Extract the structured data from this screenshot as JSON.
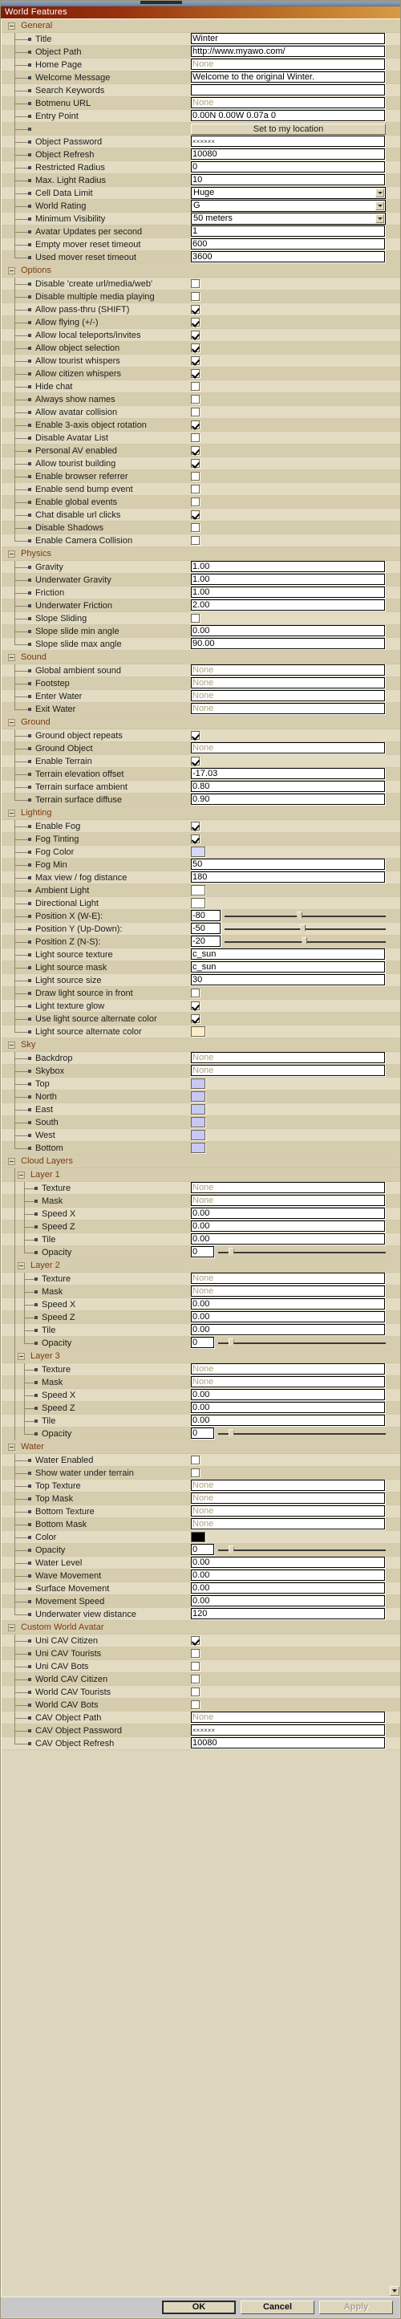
{
  "window": {
    "title": "World Features"
  },
  "buttons": {
    "ok": "OK",
    "cancel": "Cancel",
    "apply": "Apply"
  },
  "set_location_button": "Set to my location",
  "colors": {
    "fog_color": "#d8d8f8",
    "ambient_light": "#ffffff",
    "directional_light": "#ffffff",
    "light_source_alternate_color": "#fbeec6",
    "sky_top": "#c8c8f5",
    "sky_north": "#c8c8f5",
    "sky_east": "#c8c8f5",
    "sky_south": "#c8c8f5",
    "sky_west": "#c8c8f5",
    "sky_bottom": "#c8c8f5",
    "water_color": "#000000"
  },
  "groups": [
    {
      "name": "General",
      "rows": [
        {
          "label": "Title",
          "type": "text",
          "value": "Winter"
        },
        {
          "label": "Object Path",
          "type": "text",
          "value": "http://www.myawo.com/"
        },
        {
          "label": "Home Page",
          "type": "text",
          "value": "None",
          "none": true
        },
        {
          "label": "Welcome Message",
          "type": "text",
          "value": "Welcome to the original Winter."
        },
        {
          "label": "Search Keywords",
          "type": "text",
          "value": ""
        },
        {
          "label": "Botmenu URL",
          "type": "text",
          "value": "None",
          "none": true
        },
        {
          "label": "Entry Point",
          "type": "text",
          "value": "0.00N 0.00W 0.07a 0"
        },
        {
          "label": "",
          "type": "button",
          "value": "Set to my location"
        },
        {
          "label": "Object Password",
          "type": "password",
          "value": "××××××"
        },
        {
          "label": "Object Refresh",
          "type": "text",
          "value": "10080"
        },
        {
          "label": "Restricted Radius",
          "type": "text",
          "value": "0"
        },
        {
          "label": "Max. Light Radius",
          "type": "text",
          "value": "10"
        },
        {
          "label": "Cell Data Limit",
          "type": "combo",
          "value": "Huge"
        },
        {
          "label": "World Rating",
          "type": "combo",
          "value": "G"
        },
        {
          "label": "Minimum Visibility",
          "type": "combo",
          "value": "50 meters"
        },
        {
          "label": "Avatar Updates per second",
          "type": "text",
          "value": "1"
        },
        {
          "label": "Empty mover reset timeout",
          "type": "text",
          "value": "600"
        },
        {
          "label": "Used mover reset timeout",
          "type": "text",
          "value": "3600"
        }
      ]
    },
    {
      "name": "Options",
      "rows": [
        {
          "label": "Disable 'create url/media/web'",
          "type": "check",
          "value": false
        },
        {
          "label": "Disable multiple media playing",
          "type": "check",
          "value": false
        },
        {
          "label": "Allow pass-thru (SHIFT)",
          "type": "check",
          "value": true
        },
        {
          "label": "Allow flying (+/-)",
          "type": "check",
          "value": true
        },
        {
          "label": "Allow local teleports/invites",
          "type": "check",
          "value": true
        },
        {
          "label": "Allow object selection",
          "type": "check",
          "value": true
        },
        {
          "label": "Allow tourist whispers",
          "type": "check",
          "value": true
        },
        {
          "label": "Allow citizen whispers",
          "type": "check",
          "value": true
        },
        {
          "label": "Hide chat",
          "type": "check",
          "value": false
        },
        {
          "label": "Always show names",
          "type": "check",
          "value": false
        },
        {
          "label": "Allow avatar collision",
          "type": "check",
          "value": false
        },
        {
          "label": "Enable 3-axis object rotation",
          "type": "check",
          "value": true
        },
        {
          "label": "Disable Avatar List",
          "type": "check",
          "value": false
        },
        {
          "label": "Personal AV enabled",
          "type": "check",
          "value": true
        },
        {
          "label": "Allow tourist building",
          "type": "check",
          "value": true
        },
        {
          "label": "Enable browser referrer",
          "type": "check",
          "value": false
        },
        {
          "label": "Enable send bump event",
          "type": "check",
          "value": false
        },
        {
          "label": "Enable global events",
          "type": "check",
          "value": false
        },
        {
          "label": "Chat disable url clicks",
          "type": "check",
          "value": true
        },
        {
          "label": "Disable Shadows",
          "type": "check",
          "value": false
        },
        {
          "label": "Enable Camera Collision",
          "type": "check",
          "value": false
        }
      ]
    },
    {
      "name": "Physics",
      "rows": [
        {
          "label": "Gravity",
          "type": "text",
          "value": "1.00"
        },
        {
          "label": "Underwater Gravity",
          "type": "text",
          "value": "1.00"
        },
        {
          "label": "Friction",
          "type": "text",
          "value": "1.00"
        },
        {
          "label": "Underwater Friction",
          "type": "text",
          "value": "2.00"
        },
        {
          "label": "Slope Sliding",
          "type": "check",
          "value": false
        },
        {
          "label": "Slope slide min angle",
          "type": "text",
          "value": "0.00"
        },
        {
          "label": "Slope slide max angle",
          "type": "text",
          "value": "90.00"
        }
      ]
    },
    {
      "name": "Sound",
      "rows": [
        {
          "label": "Global ambient sound",
          "type": "text",
          "value": "None",
          "none": true
        },
        {
          "label": "Footstep",
          "type": "text",
          "value": "None",
          "none": true
        },
        {
          "label": "Enter Water",
          "type": "text",
          "value": "None",
          "none": true
        },
        {
          "label": "Exit Water",
          "type": "text",
          "value": "None",
          "none": true
        }
      ]
    },
    {
      "name": "Ground",
      "rows": [
        {
          "label": "Ground object repeats",
          "type": "check",
          "value": true
        },
        {
          "label": "Ground Object",
          "type": "text",
          "value": "None",
          "none": true
        },
        {
          "label": "Enable Terrain",
          "type": "check",
          "value": true
        },
        {
          "label": "Terrain elevation offset",
          "type": "text",
          "value": "-17.03"
        },
        {
          "label": "Terrain surface ambient",
          "type": "text",
          "value": "0.80"
        },
        {
          "label": "Terrain surface diffuse",
          "type": "text",
          "value": "0.90"
        }
      ]
    },
    {
      "name": "Lighting",
      "rows": [
        {
          "label": "Enable Fog",
          "type": "check",
          "value": true
        },
        {
          "label": "Fog Tinting",
          "type": "check",
          "value": true
        },
        {
          "label": "Fog Color",
          "type": "color",
          "value": "#d8d8f8"
        },
        {
          "label": "Fog Min",
          "type": "text",
          "value": "50"
        },
        {
          "label": "Max view / fog distance",
          "type": "text",
          "value": "180"
        },
        {
          "label": "Ambient Light",
          "type": "color",
          "value": "#ffffff"
        },
        {
          "label": "Directional Light",
          "type": "color",
          "value": "#ffffff"
        },
        {
          "label": "Position X (W-E):",
          "type": "slider",
          "value": "-80",
          "pos": 45
        },
        {
          "label": "Position Y (Up-Down):",
          "type": "slider",
          "value": "-50",
          "pos": 47
        },
        {
          "label": "Position Z (N-S):",
          "type": "slider",
          "value": "-20",
          "pos": 48
        },
        {
          "label": "Light source texture",
          "type": "text",
          "value": "c_sun"
        },
        {
          "label": "Light source mask",
          "type": "text",
          "value": "c_sun"
        },
        {
          "label": "Light source size",
          "type": "text",
          "value": "30"
        },
        {
          "label": "Draw light source in front",
          "type": "check",
          "value": false
        },
        {
          "label": "Light texture glow",
          "type": "check",
          "value": true
        },
        {
          "label": "Use light source alternate color",
          "type": "check",
          "value": true
        },
        {
          "label": "Light source alternate color",
          "type": "color",
          "value": "#fbeec6"
        }
      ]
    },
    {
      "name": "Sky",
      "rows": [
        {
          "label": "Backdrop",
          "type": "text",
          "value": "None",
          "none": true
        },
        {
          "label": "Skybox",
          "type": "text",
          "value": "None",
          "none": true
        },
        {
          "label": "Top",
          "type": "color",
          "value": "#c8c8f5"
        },
        {
          "label": "North",
          "type": "color",
          "value": "#c8c8f5"
        },
        {
          "label": "East",
          "type": "color",
          "value": "#c8c8f5"
        },
        {
          "label": "South",
          "type": "color",
          "value": "#c8c8f5"
        },
        {
          "label": "West",
          "type": "color",
          "value": "#c8c8f5"
        },
        {
          "label": "Bottom",
          "type": "color",
          "value": "#c8c8f5"
        }
      ]
    },
    {
      "name": "Cloud Layers",
      "subgroups": [
        {
          "name": "Layer 1",
          "rows": [
            {
              "label": "Texture",
              "type": "text",
              "value": "None",
              "none": true
            },
            {
              "label": "Mask",
              "type": "text",
              "value": "None",
              "none": true
            },
            {
              "label": "Speed X",
              "type": "text",
              "value": "0.00"
            },
            {
              "label": "Speed Z",
              "type": "text",
              "value": "0.00"
            },
            {
              "label": "Tile",
              "type": "text",
              "value": "0.00"
            },
            {
              "label": "Opacity",
              "type": "slider",
              "value": "0",
              "pos": 6
            }
          ]
        },
        {
          "name": "Layer 2",
          "rows": [
            {
              "label": "Texture",
              "type": "text",
              "value": "None",
              "none": true
            },
            {
              "label": "Mask",
              "type": "text",
              "value": "None",
              "none": true
            },
            {
              "label": "Speed X",
              "type": "text",
              "value": "0.00"
            },
            {
              "label": "Speed Z",
              "type": "text",
              "value": "0.00"
            },
            {
              "label": "Tile",
              "type": "text",
              "value": "0.00"
            },
            {
              "label": "Opacity",
              "type": "slider",
              "value": "0",
              "pos": 6
            }
          ]
        },
        {
          "name": "Layer 3",
          "rows": [
            {
              "label": "Texture",
              "type": "text",
              "value": "None",
              "none": true
            },
            {
              "label": "Mask",
              "type": "text",
              "value": "None",
              "none": true
            },
            {
              "label": "Speed X",
              "type": "text",
              "value": "0.00"
            },
            {
              "label": "Speed Z",
              "type": "text",
              "value": "0.00"
            },
            {
              "label": "Tile",
              "type": "text",
              "value": "0.00"
            },
            {
              "label": "Opacity",
              "type": "slider",
              "value": "0",
              "pos": 6
            }
          ]
        }
      ]
    },
    {
      "name": "Water",
      "rows": [
        {
          "label": "Water Enabled",
          "type": "check",
          "value": false
        },
        {
          "label": "Show water under terrain",
          "type": "check",
          "value": false
        },
        {
          "label": "Top Texture",
          "type": "text",
          "value": "None",
          "none": true
        },
        {
          "label": "Top Mask",
          "type": "text",
          "value": "None",
          "none": true
        },
        {
          "label": "Bottom Texture",
          "type": "text",
          "value": "None",
          "none": true
        },
        {
          "label": "Bottom Mask",
          "type": "text",
          "value": "None",
          "none": true
        },
        {
          "label": "Color",
          "type": "color",
          "value": "#000000"
        },
        {
          "label": "Opacity",
          "type": "slider",
          "value": "0",
          "pos": 6
        },
        {
          "label": "Water Level",
          "type": "text",
          "value": "0.00"
        },
        {
          "label": "Wave Movement",
          "type": "text",
          "value": "0.00"
        },
        {
          "label": "Surface Movement",
          "type": "text",
          "value": "0.00"
        },
        {
          "label": "Movement Speed",
          "type": "text",
          "value": "0.00"
        },
        {
          "label": "Underwater view distance",
          "type": "text",
          "value": "120"
        }
      ]
    },
    {
      "name": "Custom World Avatar",
      "rows": [
        {
          "label": "Uni CAV Citizen",
          "type": "check",
          "value": true
        },
        {
          "label": "Uni CAV Tourists",
          "type": "check",
          "value": false
        },
        {
          "label": "Uni CAV Bots",
          "type": "check",
          "value": false
        },
        {
          "label": "World CAV Citizen",
          "type": "check",
          "value": false
        },
        {
          "label": "World CAV Tourists",
          "type": "check",
          "value": false
        },
        {
          "label": "World CAV Bots",
          "type": "check",
          "value": false
        },
        {
          "label": "CAV Object Path",
          "type": "text",
          "value": "None",
          "none": true
        },
        {
          "label": "CAV Object Password",
          "type": "password",
          "value": "××××××"
        },
        {
          "label": "CAV Object Refresh",
          "type": "text",
          "value": "10080"
        }
      ]
    }
  ]
}
